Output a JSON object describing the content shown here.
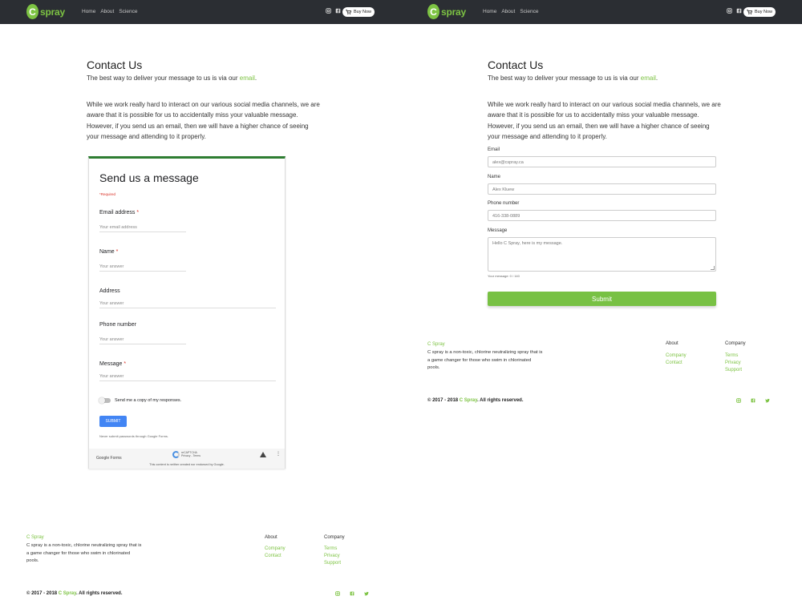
{
  "nav": {
    "logo_letter": "C",
    "logo_text": "spray",
    "links": [
      "Home",
      "About",
      "Science"
    ],
    "buy_label": "Buy Now",
    "icons": [
      "instagram-icon",
      "facebook-icon",
      "cart-icon"
    ]
  },
  "contact": {
    "title": "Contact Us",
    "subtitle_prefix": "The best way to deliver your message to us is via our ",
    "subtitle_link": "email",
    "subtitle_suffix": ".",
    "paragraph": "While we work really hard to interact on our various social media channels, we are aware that it is possible for us to accidentally miss your valuable message. However, if you send us an email, then we will have a higher chance of seeing your message and attending to it properly."
  },
  "google_form": {
    "title": "Send us a message",
    "required_note": "*Required",
    "questions": [
      {
        "label": "Email address",
        "required": "*",
        "placeholder": "Your email address"
      },
      {
        "label": "Name",
        "required": "*",
        "placeholder": "Your answer"
      },
      {
        "label": "Address",
        "required": "",
        "placeholder": "Your answer"
      },
      {
        "label": "Phone number",
        "required": "",
        "placeholder": "Your answer"
      },
      {
        "label": "Message",
        "required": "*",
        "placeholder": "Your answer"
      }
    ],
    "copy_label": "Send me a copy of my responses.",
    "submit_label": "SUBMIT",
    "never_submit": "Never submit passwords through Google Forms.",
    "brand": "Google Forms",
    "recaptcha_title": "reCAPTCHA",
    "recaptcha_links": "Privacy - Terms",
    "disclaimer": "This content is neither created nor endorsed by Google."
  },
  "contact_form": {
    "email_label": "Email",
    "email_value": "alex@cspray.ca",
    "name_label": "Name",
    "name_value": "Alex Kluew",
    "phone_label": "Phone number",
    "phone_value": "416-338-0889",
    "message_label": "Message",
    "message_value": "Hello C Spray, here is my message.",
    "counter": "Your message: 0 / 140",
    "submit_label": "Submit"
  },
  "footer": {
    "brand": "C Spray",
    "description": "C spray is a non-toxic, chlorine neutralizing spray that is a game changer for those who swim in chlorinated pools.",
    "about_heading": "About",
    "about_links": [
      "Company",
      "Contact"
    ],
    "company_heading": "Company",
    "company_links": [
      "Terms",
      "Privacy",
      "Support"
    ],
    "copyright_prefix": "© 2017 - 2018 ",
    "copyright_brand": "C Spray",
    "copyright_suffix": ". All rights reserved.",
    "social": [
      "instagram-icon",
      "facebook-icon",
      "twitter-icon"
    ]
  },
  "colors": {
    "brand_green": "#7dc343",
    "nav_bg": "#2b2e33",
    "button_green": "#78c144",
    "google_blue": "#4285f4",
    "form_accent": "#2e7d32"
  }
}
